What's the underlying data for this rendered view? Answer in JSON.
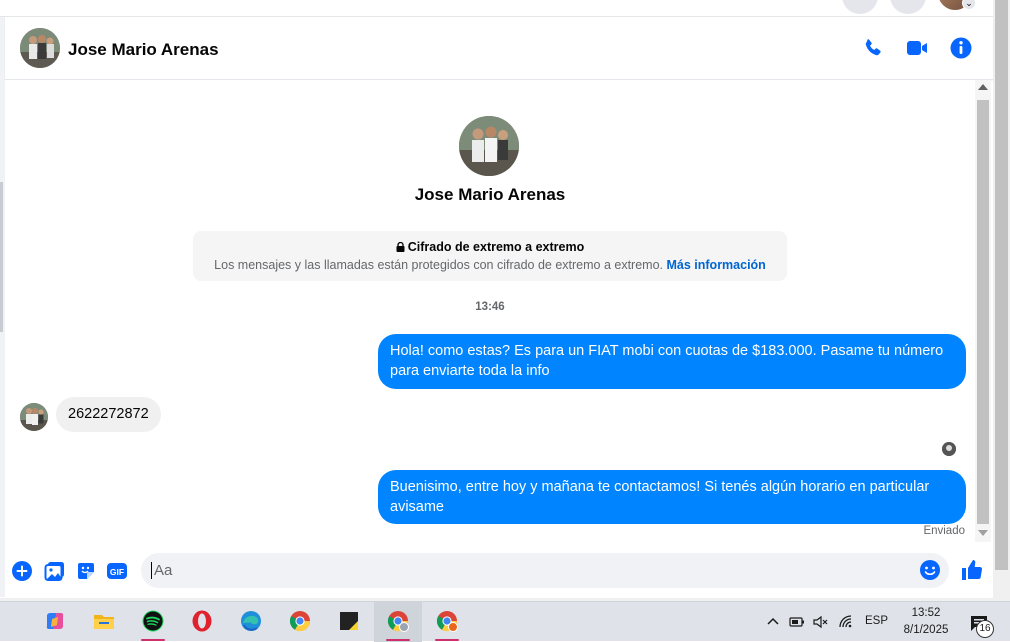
{
  "colors": {
    "accent": "#0084ff",
    "link": "#0064d1",
    "icon_blue": "#0866ff"
  },
  "header": {
    "contact_name": "Jose Mario Arenas"
  },
  "profile": {
    "name": "Jose Mario Arenas"
  },
  "encryption": {
    "title": "Cifrado de extremo a extremo",
    "text": "Los mensajes y las llamadas están protegidos con cifrado de extremo a extremo.",
    "link": "Más información"
  },
  "messages": {
    "timestamp": "13:46",
    "items": [
      {
        "direction": "out",
        "text": "Hola! como estas? Es para un FIAT mobi con cuotas de $183.000. Pasame tu número para enviarte toda la info"
      },
      {
        "direction": "in",
        "text": "2622272872"
      },
      {
        "direction": "out",
        "text": "Buenisimo, entre hoy y mañana te contactamos! Si tenés algún horario en particular avisame"
      }
    ],
    "status": "Enviado"
  },
  "composer": {
    "placeholder": "Aa"
  },
  "taskbar": {
    "apps": [
      "copilot-icon",
      "file-explorer-icon",
      "spotify-icon",
      "opera-icon",
      "edge-icon",
      "chrome-icon",
      "sticky-notes-icon",
      "chrome-profile-icon",
      "chrome-profile-2-icon"
    ],
    "language": "ESP",
    "time": "13:52",
    "date": "8/1/2025",
    "notifications": "16"
  }
}
